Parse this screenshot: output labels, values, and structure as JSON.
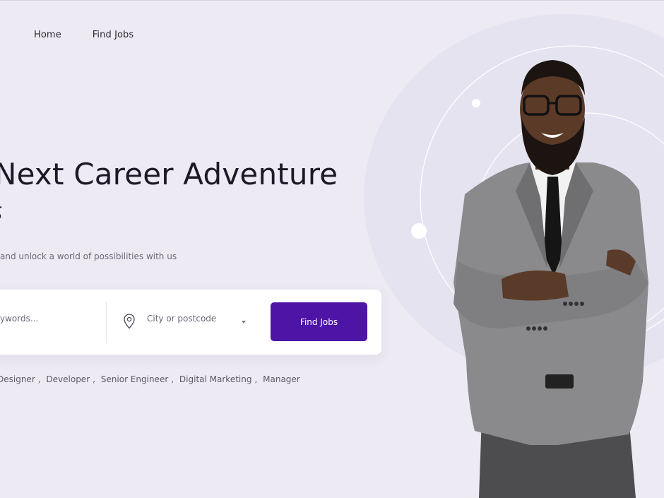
{
  "nav": {
    "items": [
      {
        "label": "Home"
      },
      {
        "label": "Find Jobs"
      }
    ]
  },
  "hero": {
    "title": "Next Career Adventure",
    "description": "and unlock a world of possibilities with us"
  },
  "search": {
    "keywords_placeholder": "ywords...",
    "location_value": "City or postcode",
    "button_label": "Find Jobs"
  },
  "popular_tags": [
    "Designer",
    "Developer",
    "Senior Engineer",
    "Digital Marketing",
    "Manager"
  ],
  "colors": {
    "background": "#edeaf4",
    "accent": "#4e14a6",
    "card": "#ffffff"
  }
}
